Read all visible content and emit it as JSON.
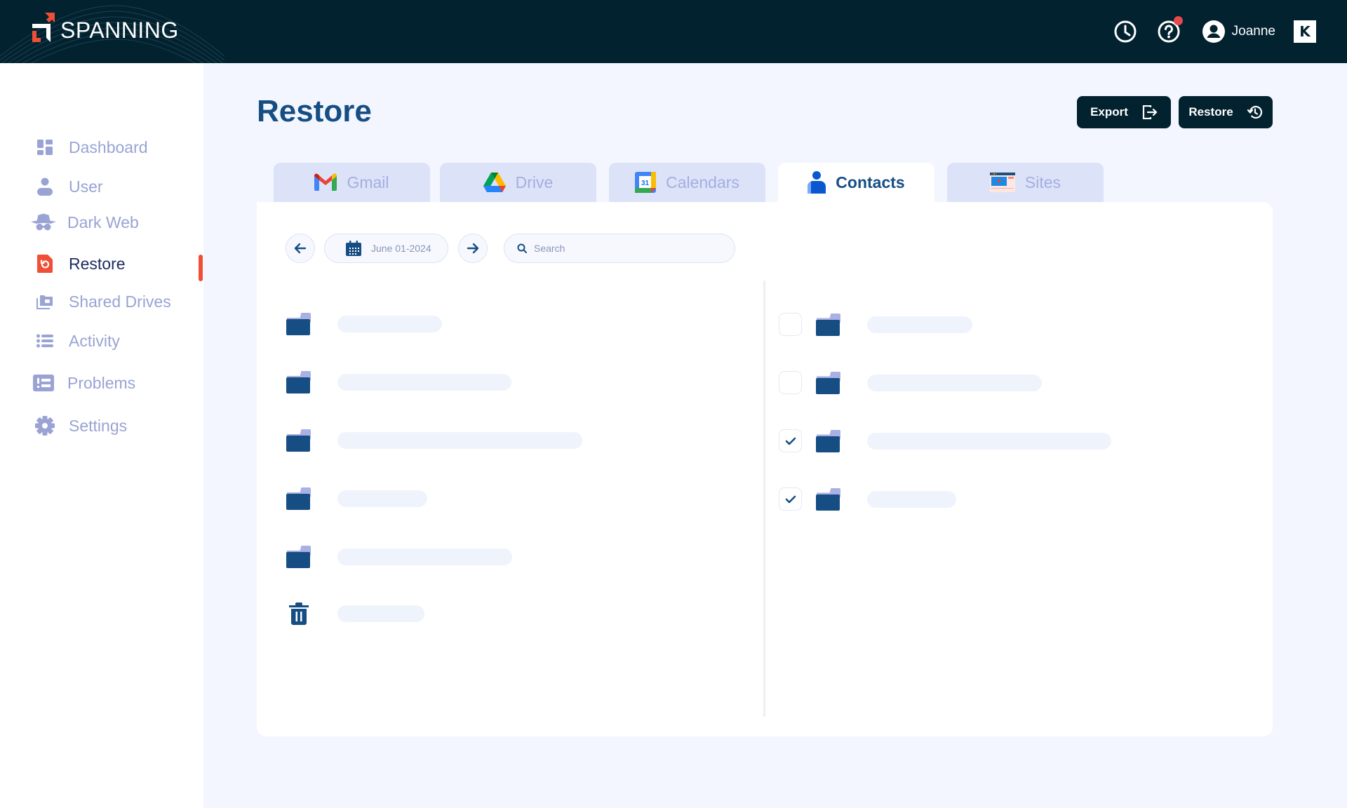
{
  "header": {
    "brand": "SPANNING",
    "user_name": "Joanne",
    "icons": [
      "history-icon",
      "help-icon",
      "user-avatar-icon",
      "kaseya-logo-icon"
    ],
    "has_notification": true,
    "brand_letter": "K"
  },
  "sidebar": {
    "items": [
      {
        "label": "Dashboard",
        "icon": "dashboard-icon",
        "active": false
      },
      {
        "label": "User",
        "icon": "user-icon",
        "active": false
      },
      {
        "label": "Dark Web",
        "icon": "spy-icon",
        "active": false
      },
      {
        "label": "Restore",
        "icon": "restore-file-icon",
        "active": true
      },
      {
        "label": "Shared Drives",
        "icon": "shared-drives-icon",
        "active": false
      },
      {
        "label": "Activity",
        "icon": "list-icon",
        "active": false
      },
      {
        "label": "Problems",
        "icon": "problems-icon",
        "active": false
      },
      {
        "label": "Settings",
        "icon": "gear-icon",
        "active": false
      }
    ]
  },
  "page": {
    "title": "Restore",
    "export_label": "Export",
    "restore_label": "Restore"
  },
  "tabs": [
    {
      "label": "Gmail",
      "icon": "gmail-icon",
      "active": false
    },
    {
      "label": "Drive",
      "icon": "google-drive-icon",
      "active": false
    },
    {
      "label": "Calendars",
      "icon": "google-calendar-icon",
      "calendar_day": "31",
      "active": false
    },
    {
      "label": "Contacts",
      "icon": "contacts-icon",
      "active": true
    },
    {
      "label": "Sites",
      "icon": "google-sites-icon",
      "active": false
    }
  ],
  "toolbar": {
    "date": "June 01-2024",
    "search_placeholder": "Search",
    "search_value": ""
  },
  "left_list": [
    {
      "icon": "folder-icon",
      "state": "loading"
    },
    {
      "icon": "folder-icon",
      "state": "loading"
    },
    {
      "icon": "folder-icon",
      "state": "loading"
    },
    {
      "icon": "folder-icon",
      "state": "loading"
    },
    {
      "icon": "folder-icon",
      "state": "loading"
    },
    {
      "icon": "trash-icon",
      "state": "loading"
    }
  ],
  "right_list": [
    {
      "icon": "folder-icon",
      "checked": false,
      "state": "loading"
    },
    {
      "icon": "folder-icon",
      "checked": false,
      "state": "loading"
    },
    {
      "icon": "folder-icon",
      "checked": true,
      "state": "loading"
    },
    {
      "icon": "folder-icon",
      "checked": true,
      "state": "loading"
    }
  ],
  "colors": {
    "header_bg": "#03222F",
    "accent": "#F04E37",
    "primary_text": "#164E84",
    "muted_nav": "#9AA3D4"
  }
}
